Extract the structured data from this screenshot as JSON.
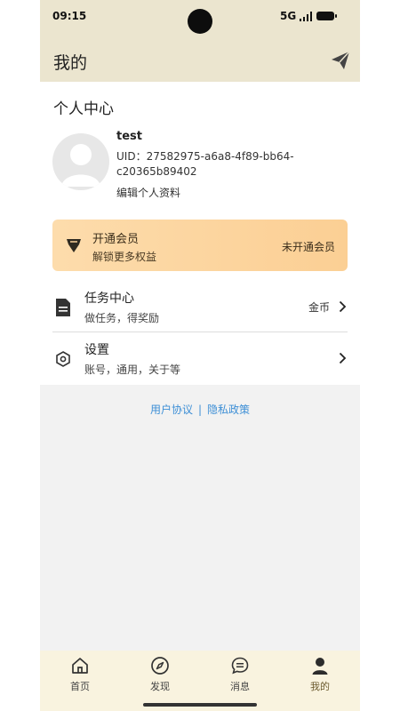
{
  "status_bar": {
    "time": "09:15",
    "network": "5G"
  },
  "header": {
    "title": "我的"
  },
  "profile": {
    "section_title": "个人中心",
    "username": "test",
    "uid": "UID：27582975-a6a8-4f89-bb64-c20365b89402",
    "edit_label": "编辑个人资料"
  },
  "vip": {
    "title": "开通会员",
    "subtitle": "解锁更多权益",
    "status": "未开通会员"
  },
  "menu": [
    {
      "label": "任务中心",
      "desc": "做任务，得奖励",
      "extra": "金币",
      "icon": "document-icon"
    },
    {
      "label": "设置",
      "desc": "账号，通用，关于等",
      "extra": "",
      "icon": "settings-hex-icon"
    }
  ],
  "footer": {
    "user_agreement": "用户协议",
    "separator": "|",
    "privacy_policy": "隐私政策"
  },
  "tabs": [
    {
      "label": "首页",
      "icon": "home-icon"
    },
    {
      "label": "发现",
      "icon": "compass-icon"
    },
    {
      "label": "消息",
      "icon": "message-icon"
    },
    {
      "label": "我的",
      "icon": "person-icon",
      "active": true
    }
  ],
  "colors": {
    "header_bg": "#ebe5cf",
    "tabbar_bg": "#f9f3df",
    "vip_gradient_start": "#fddcac",
    "vip_gradient_end": "#fbcf94",
    "link": "#3d8fd6"
  }
}
